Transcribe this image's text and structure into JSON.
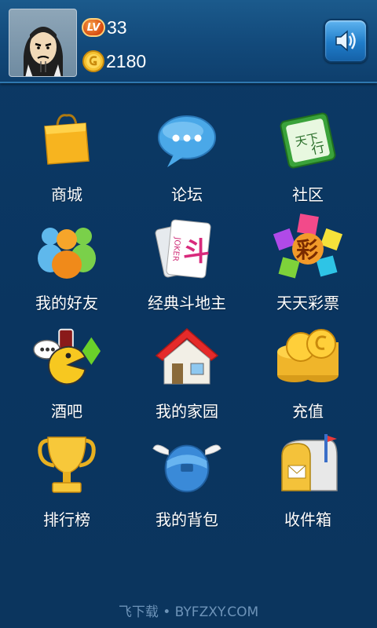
{
  "profile": {
    "level_badge": "LV",
    "level": "33",
    "coins": "2180"
  },
  "menu": [
    {
      "label": "商城",
      "icon": "shopping-bag-icon"
    },
    {
      "label": "论坛",
      "icon": "chat-bubble-icon"
    },
    {
      "label": "社区",
      "icon": "community-icon"
    },
    {
      "label": "我的好友",
      "icon": "friends-icon"
    },
    {
      "label": "经典斗地主",
      "icon": "poker-cards-icon"
    },
    {
      "label": "天天彩票",
      "icon": "lottery-icon"
    },
    {
      "label": "酒吧",
      "icon": "bar-icon"
    },
    {
      "label": "我的家园",
      "icon": "home-icon"
    },
    {
      "label": "充值",
      "icon": "coins-icon"
    },
    {
      "label": "排行榜",
      "icon": "trophy-icon"
    },
    {
      "label": "我的背包",
      "icon": "backpack-icon"
    },
    {
      "label": "收件箱",
      "icon": "mailbox-icon"
    }
  ],
  "icon_texts": {
    "community": "天下",
    "community2": "行",
    "joker": "JOKER",
    "poker": "斗",
    "lottery": "彩"
  },
  "watermark": "飞下载 • BYFZXY.COM",
  "colors": {
    "background": "#0b3860",
    "header": "#14497a",
    "accent": "#2f78b0"
  }
}
